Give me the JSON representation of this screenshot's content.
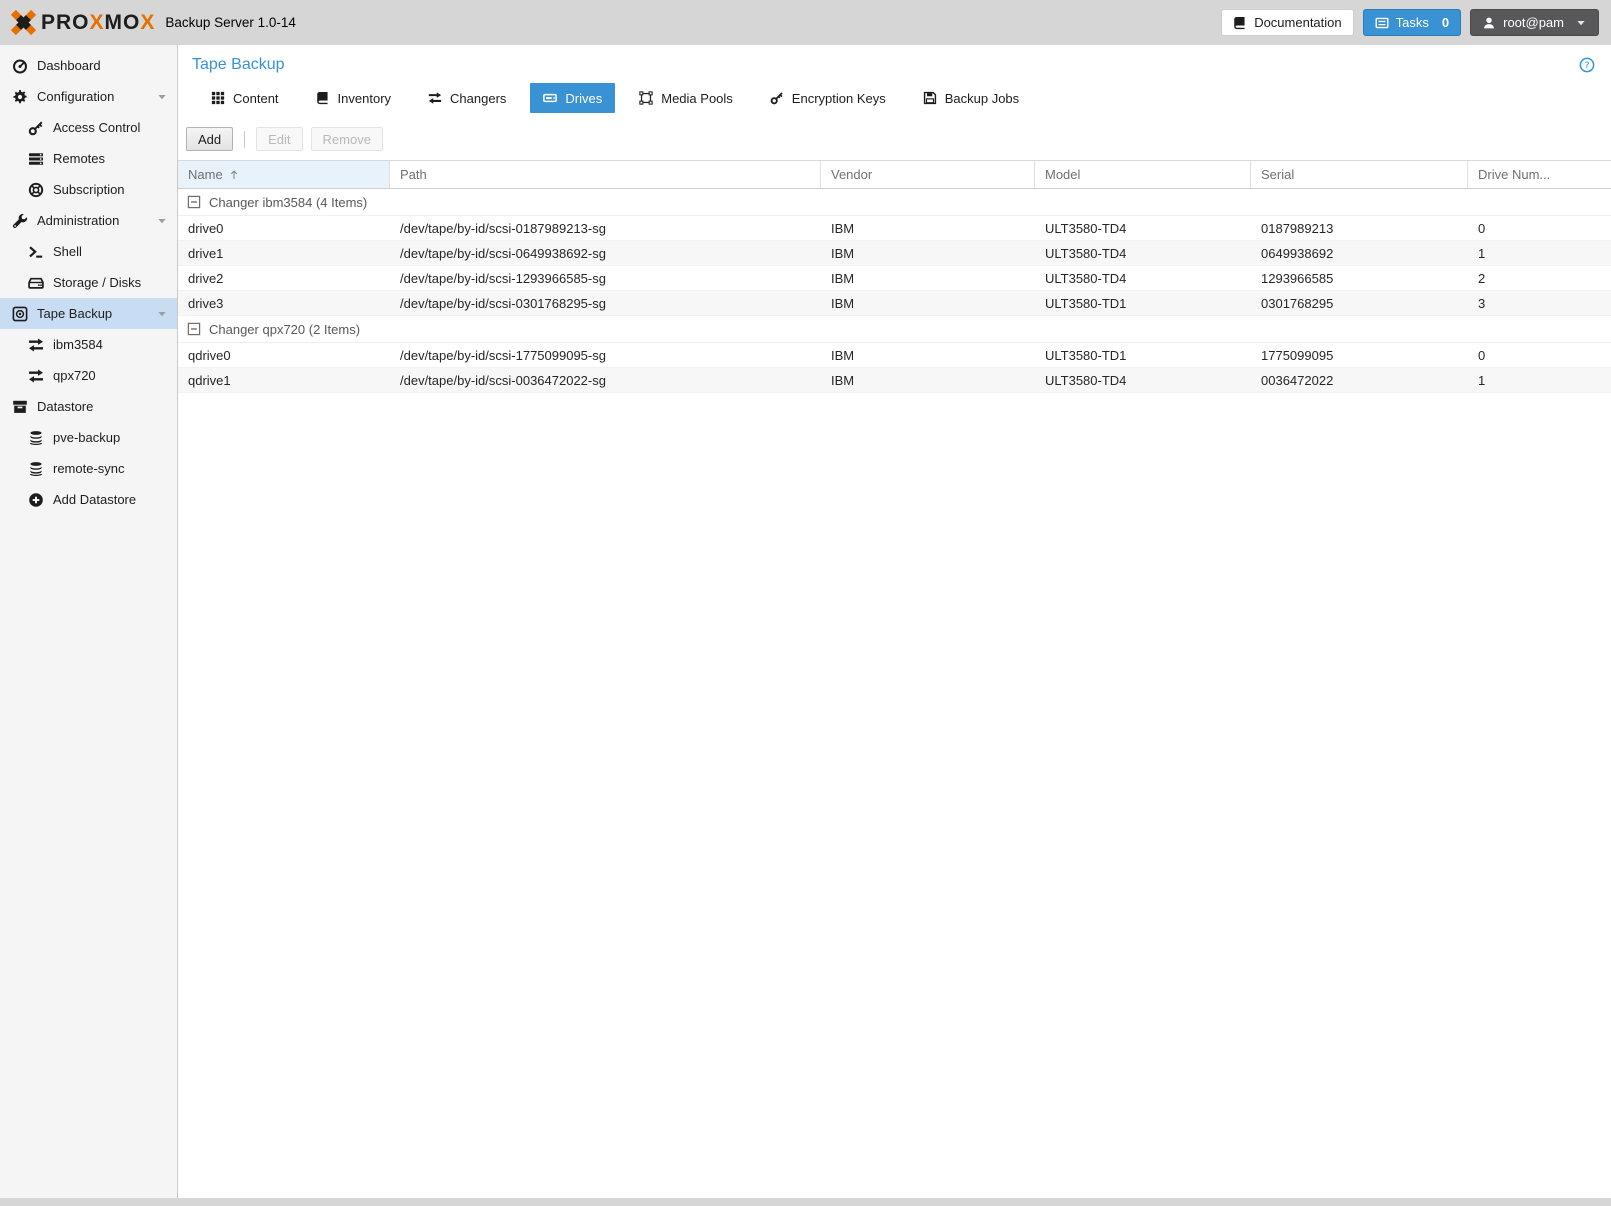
{
  "brand": {
    "logo_icon": "proxmox-x-icon",
    "word_parts": [
      "PRO",
      "X",
      "MO",
      "X"
    ],
    "app_title": "Backup Server 1.0-14"
  },
  "header": {
    "documentation_label": "Documentation",
    "documentation_icon": "book-icon",
    "tasks_label": "Tasks",
    "tasks_count": "0",
    "tasks_icon": "task-list-icon",
    "user_label": "root@pam",
    "user_icon": "user-icon",
    "user_caret_icon": "chevron-down-icon"
  },
  "sidebar": {
    "items": [
      {
        "label": "Dashboard",
        "icon": "gauge-icon",
        "level": 0,
        "selected": false
      },
      {
        "label": "Configuration",
        "icon": "gear-icon",
        "level": 0,
        "selected": false,
        "expandable": true
      },
      {
        "label": "Access Control",
        "icon": "key-icon",
        "level": 1,
        "selected": false
      },
      {
        "label": "Remotes",
        "icon": "server-list-icon",
        "level": 1,
        "selected": false
      },
      {
        "label": "Subscription",
        "icon": "lifering-icon",
        "level": 1,
        "selected": false
      },
      {
        "label": "Administration",
        "icon": "wrench-icon",
        "level": 0,
        "selected": false,
        "expandable": true
      },
      {
        "label": "Shell",
        "icon": "terminal-icon",
        "level": 1,
        "selected": false
      },
      {
        "label": "Storage / Disks",
        "icon": "hdd-icon",
        "level": 1,
        "selected": false
      },
      {
        "label": "Tape Backup",
        "icon": "tape-icon",
        "level": 0,
        "selected": true,
        "expandable": true
      },
      {
        "label": "ibm3584",
        "icon": "exchange-icon",
        "level": 1,
        "selected": false
      },
      {
        "label": "qpx720",
        "icon": "exchange-icon",
        "level": 1,
        "selected": false
      },
      {
        "label": "Datastore",
        "icon": "datastore-box-icon",
        "level": 0,
        "selected": false
      },
      {
        "label": "pve-backup",
        "icon": "database-icon",
        "level": 1,
        "selected": false
      },
      {
        "label": "remote-sync",
        "icon": "database-icon",
        "level": 1,
        "selected": false
      },
      {
        "label": "Add Datastore",
        "icon": "plus-circle-icon",
        "level": 1,
        "selected": false
      }
    ]
  },
  "main": {
    "title": "Tape Backup",
    "help_icon": "help-circle-icon",
    "tabs": [
      {
        "label": "Content",
        "icon": "grid-icon",
        "active": false
      },
      {
        "label": "Inventory",
        "icon": "book-icon",
        "active": false
      },
      {
        "label": "Changers",
        "icon": "exchange-icon",
        "active": false
      },
      {
        "label": "Drives",
        "icon": "tape-drive-icon",
        "active": true
      },
      {
        "label": "Media Pools",
        "icon": "object-group-icon",
        "active": false
      },
      {
        "label": "Encryption Keys",
        "icon": "key-icon",
        "active": false
      },
      {
        "label": "Backup Jobs",
        "icon": "floppy-icon",
        "active": false
      }
    ],
    "toolbar": {
      "add_label": "Add",
      "edit_label": "Edit",
      "remove_label": "Remove",
      "edit_disabled": true,
      "remove_disabled": true
    },
    "table": {
      "columns": [
        "Name",
        "Path",
        "Vendor",
        "Model",
        "Serial",
        "Drive Num..."
      ],
      "sorted_column": "Name",
      "sort_direction": "asc",
      "groups": [
        {
          "label": "Changer ibm3584 (4 Items)",
          "collapse_icon": "minus-square-icon",
          "rows": [
            {
              "name": "drive0",
              "path": "/dev/tape/by-id/scsi-0187989213-sg",
              "vendor": "IBM",
              "model": "ULT3580-TD4",
              "serial": "0187989213",
              "drive_num": "0"
            },
            {
              "name": "drive1",
              "path": "/dev/tape/by-id/scsi-0649938692-sg",
              "vendor": "IBM",
              "model": "ULT3580-TD4",
              "serial": "0649938692",
              "drive_num": "1"
            },
            {
              "name": "drive2",
              "path": "/dev/tape/by-id/scsi-1293966585-sg",
              "vendor": "IBM",
              "model": "ULT3580-TD4",
              "serial": "1293966585",
              "drive_num": "2"
            },
            {
              "name": "drive3",
              "path": "/dev/tape/by-id/scsi-0301768295-sg",
              "vendor": "IBM",
              "model": "ULT3580-TD1",
              "serial": "0301768295",
              "drive_num": "3"
            }
          ]
        },
        {
          "label": "Changer qpx720 (2 Items)",
          "collapse_icon": "minus-square-icon",
          "rows": [
            {
              "name": "qdrive0",
              "path": "/dev/tape/by-id/scsi-1775099095-sg",
              "vendor": "IBM",
              "model": "ULT3580-TD1",
              "serial": "1775099095",
              "drive_num": "0"
            },
            {
              "name": "qdrive1",
              "path": "/dev/tape/by-id/scsi-0036472022-sg",
              "vendor": "IBM",
              "model": "ULT3580-TD4",
              "serial": "0036472022",
              "drive_num": "1"
            }
          ]
        }
      ]
    }
  },
  "colors": {
    "accent_blue": "#3892d4",
    "brand_orange": "#e57000",
    "selected_sidebar_bg": "#c8ddf3",
    "topbar_bg": "#d6d6d6",
    "sidebar_bg": "#f5f5f5"
  }
}
